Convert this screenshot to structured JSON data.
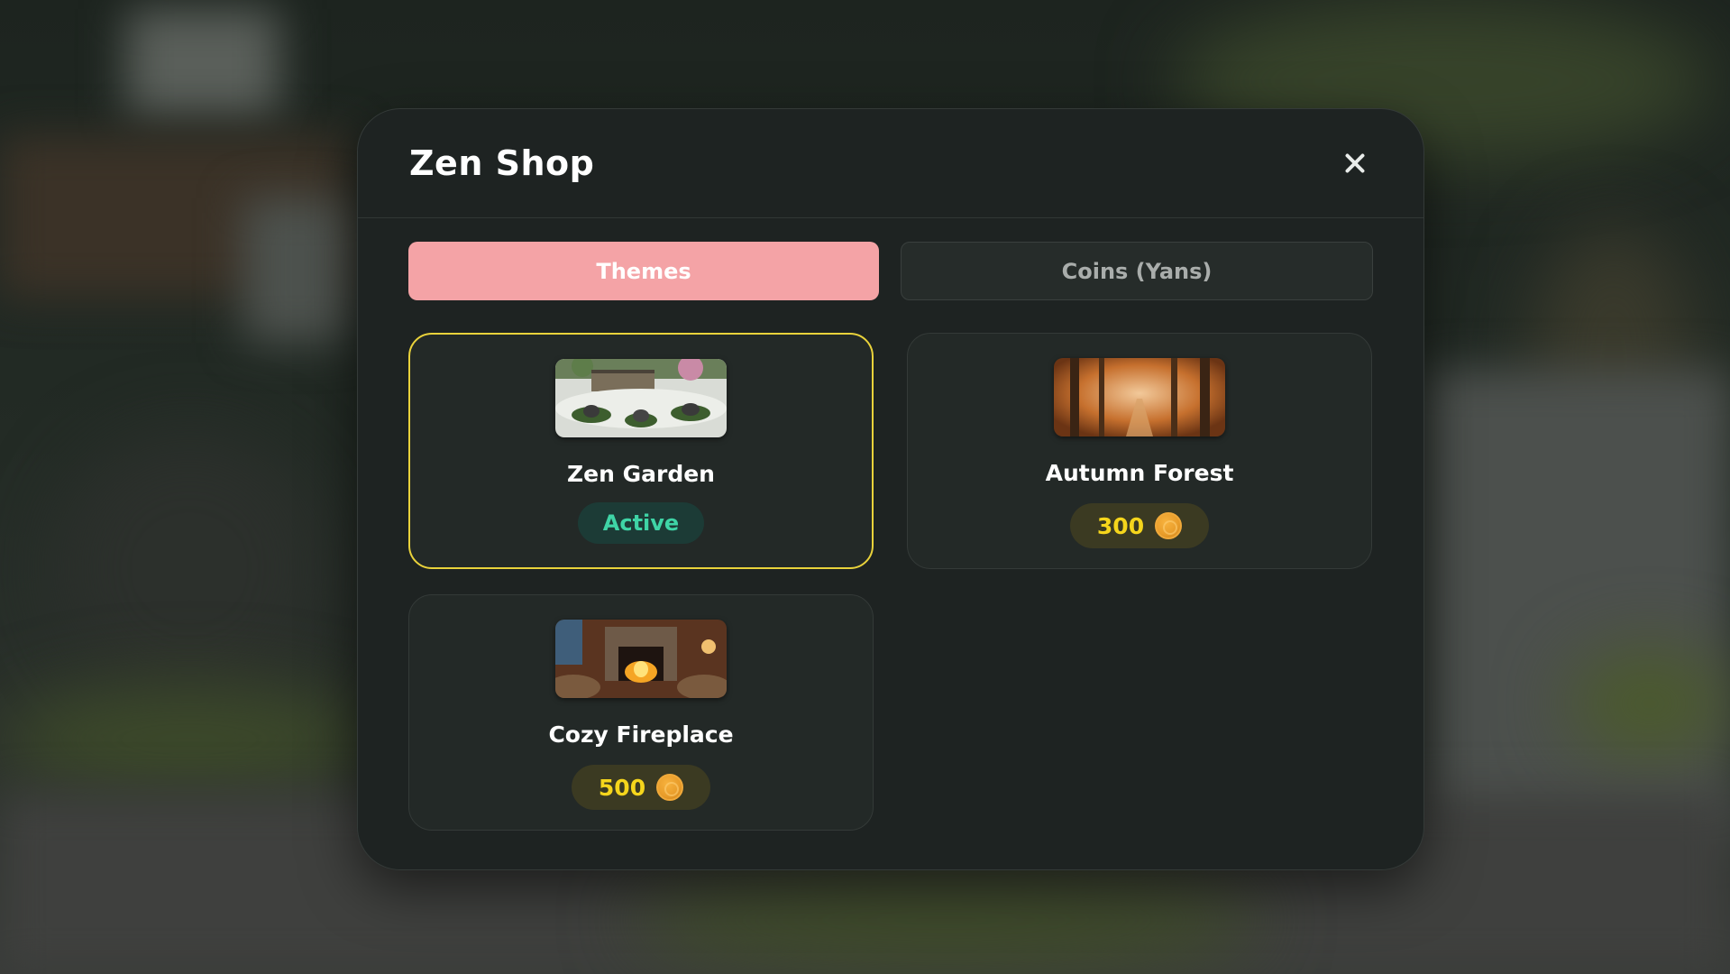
{
  "shop": {
    "title": "Zen Shop",
    "close_icon": "close-icon"
  },
  "tabs": [
    {
      "label": "Themes",
      "active": true
    },
    {
      "label": "Coins (Yans)",
      "active": false
    }
  ],
  "themes": [
    {
      "name": "Zen Garden",
      "status": "Active",
      "thumbnail": "zen-garden-image"
    },
    {
      "name": "Autumn Forest",
      "price": "300",
      "currency_icon": "coin-icon",
      "thumbnail": "autumn-forest-image"
    },
    {
      "name": "Cozy Fireplace",
      "price": "500",
      "currency_icon": "coin-icon",
      "thumbnail": "cozy-fireplace-image"
    }
  ],
  "colors": {
    "active_tab": "#f4a3a6",
    "selected_border": "#e9d23b",
    "active_status": "#3fd4a6",
    "price": "#f5d51c",
    "modal_bg": "#1e2322"
  }
}
